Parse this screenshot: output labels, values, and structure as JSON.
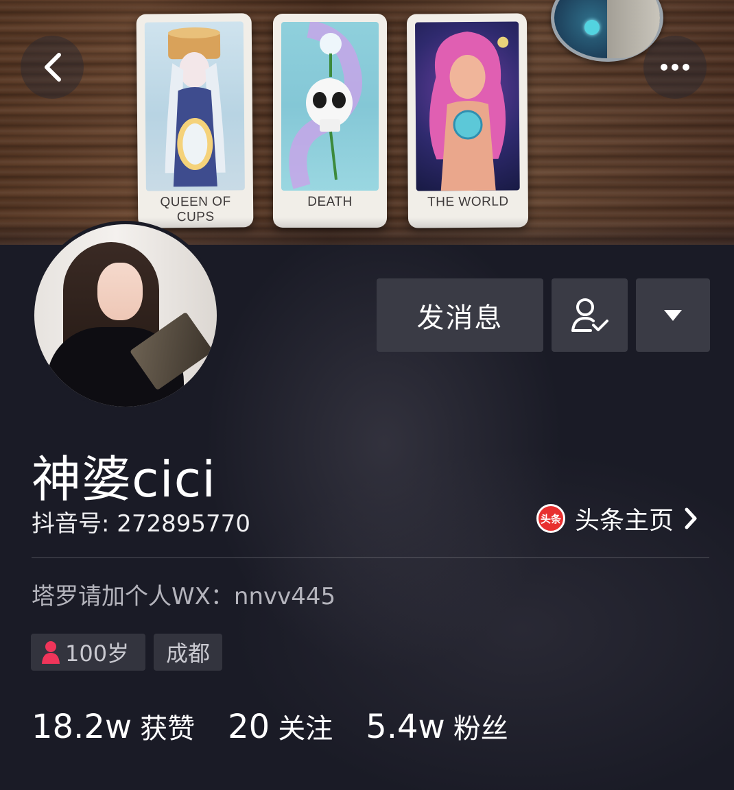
{
  "cover": {
    "cards": [
      {
        "caption": "QUEEN OF CUPS"
      },
      {
        "caption": "DEATH"
      },
      {
        "caption": "THE WORLD"
      }
    ]
  },
  "nav": {
    "back_icon": "chevron-left-icon",
    "more_icon": "more-dots-icon"
  },
  "actions": {
    "message_label": "发消息",
    "follow_icon": "user-check-icon",
    "dropdown_icon": "triangle-down-icon"
  },
  "profile": {
    "name": "神婆cici",
    "douyin_id": "抖音号: 272895770",
    "toutiao_badge": "头条",
    "toutiao_label": "头条主页",
    "bio": "塔罗请加个人WX：nnvv445",
    "tags": {
      "age": "100岁",
      "city": "成都"
    }
  },
  "stats": [
    {
      "value": "18.2w",
      "label": "获赞"
    },
    {
      "value": "20",
      "label": "关注"
    },
    {
      "value": "5.4w",
      "label": "粉丝"
    }
  ],
  "colors": {
    "background": "#1a1b26",
    "button": "#3a3b45",
    "toutiao_red": "#e8302f",
    "bio_text": "#b4b4bc"
  }
}
